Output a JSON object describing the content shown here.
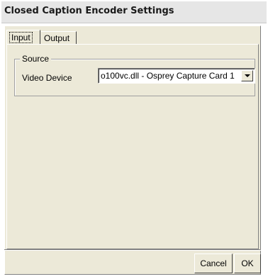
{
  "window": {
    "title": "Closed Caption Encoder Settings"
  },
  "tabs": [
    {
      "label": "Input",
      "selected": true
    },
    {
      "label": "Output",
      "selected": false
    }
  ],
  "source_group": {
    "label": "Source",
    "video_device_label": "Video Device",
    "video_device_value": "o100vc.dll - Osprey Capture Card 1"
  },
  "buttons": {
    "cancel_label": "Cancel",
    "ok_label": "OK"
  }
}
